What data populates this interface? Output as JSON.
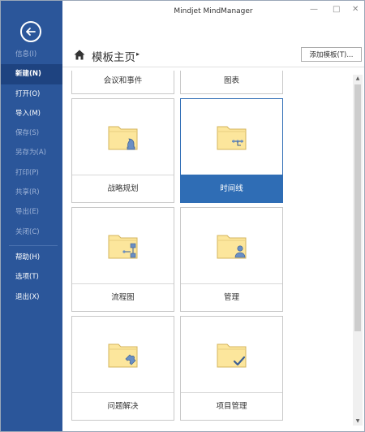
{
  "app": {
    "title": "Mindjet MindManager"
  },
  "window": {
    "minimize": "—",
    "maximize": "□",
    "close": "✕"
  },
  "sidebar": {
    "items": [
      {
        "label": "信息(I)",
        "state": "disabled"
      },
      {
        "label": "新建(N)",
        "state": "active"
      },
      {
        "label": "打开(O)",
        "state": "normal"
      },
      {
        "label": "导入(M)",
        "state": "normal"
      },
      {
        "label": "保存(S)",
        "state": "disabled"
      },
      {
        "label": "另存为(A)",
        "state": "disabled"
      },
      {
        "label": "打印(P)",
        "state": "disabled"
      },
      {
        "label": "共享(R)",
        "state": "disabled"
      },
      {
        "label": "导出(E)",
        "state": "disabled"
      },
      {
        "label": "关闭(C)",
        "state": "disabled"
      },
      {
        "label": "帮助(H)",
        "state": "normal"
      },
      {
        "label": "选项(T)",
        "state": "normal"
      },
      {
        "label": "退出(X)",
        "state": "normal"
      }
    ]
  },
  "header": {
    "title": "模板主页",
    "arrow": "▸",
    "add_button": "添加模板(T)..."
  },
  "tiles": [
    {
      "label": "会议和事件",
      "icon": "none"
    },
    {
      "label": "图表",
      "icon": "none"
    },
    {
      "label": "战略规划",
      "icon": "chess-knight-icon"
    },
    {
      "label": "时间线",
      "icon": "timeline-icon",
      "selected": true
    },
    {
      "label": "流程图",
      "icon": "flowchart-icon"
    },
    {
      "label": "管理",
      "icon": "person-icon"
    },
    {
      "label": "问题解决",
      "icon": "puzzle-icon"
    },
    {
      "label": "项目管理",
      "icon": "checkmark-icon"
    }
  ],
  "scrollbar": {
    "up": "▲",
    "down": "▼"
  },
  "colors": {
    "sidebar": "#2b569a",
    "accent": "#2f6db5",
    "folder": "#fce69c"
  }
}
